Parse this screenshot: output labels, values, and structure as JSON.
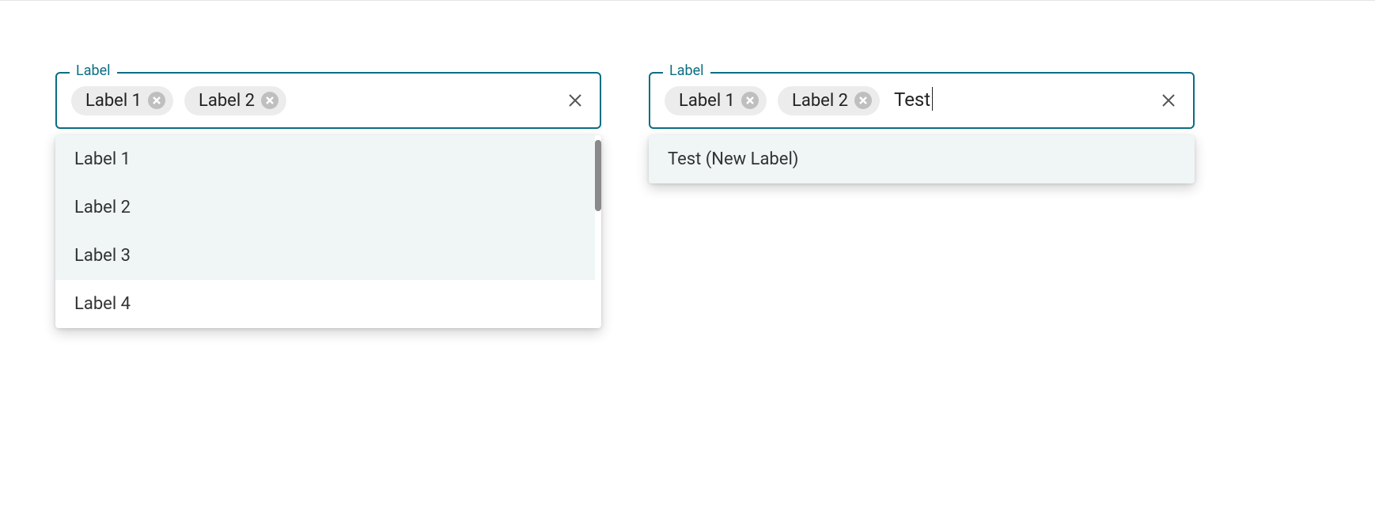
{
  "left": {
    "label": "Label",
    "chips": [
      {
        "text": "Label 1"
      },
      {
        "text": "Label 2"
      }
    ],
    "options": [
      {
        "text": "Label 1",
        "highlighted": true
      },
      {
        "text": "Label 2",
        "highlighted": true
      },
      {
        "text": "Label 3",
        "highlighted": true
      },
      {
        "text": "Label 4",
        "highlighted": false
      }
    ]
  },
  "right": {
    "label": "Label",
    "chips": [
      {
        "text": "Label 1"
      },
      {
        "text": "Label 2"
      }
    ],
    "input_value": "Test",
    "options": [
      {
        "text": "Test (New Label)",
        "highlighted": true
      }
    ]
  }
}
